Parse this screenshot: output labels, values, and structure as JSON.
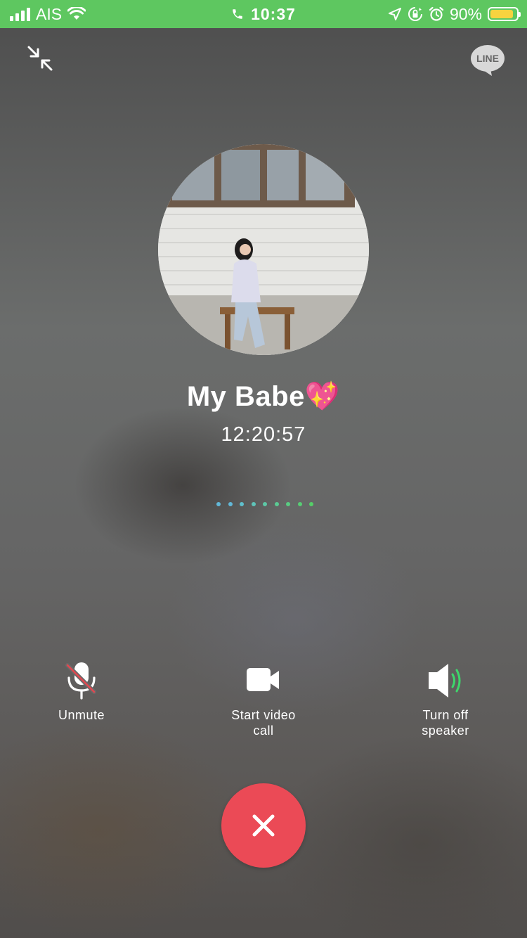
{
  "status_bar": {
    "carrier": "AIS",
    "time": "10:37",
    "battery_percent": "90%",
    "battery_level": 0.9,
    "icons": [
      "signal-icon",
      "wifi-icon",
      "phone-icon",
      "location-icon",
      "rotation-lock-icon",
      "alarm-icon",
      "battery-icon"
    ]
  },
  "header": {
    "minimize_icon": "minimize-icon",
    "logo_text": "LINE"
  },
  "call": {
    "contact_name": "My Babe💖",
    "duration": "12:20:57",
    "dot_colors": [
      "#62b8d8",
      "#62b8d8",
      "#5fbfcc",
      "#5fc4b9",
      "#5dc8a6",
      "#5bca93",
      "#59cc82",
      "#57cd74",
      "#55ce68"
    ]
  },
  "controls": {
    "mute": {
      "label": "Unmute",
      "icon": "microphone-off-icon"
    },
    "video": {
      "label": "Start video\ncall",
      "icon": "video-camera-icon"
    },
    "speaker": {
      "label": "Turn off\nspeaker",
      "icon": "speaker-on-icon"
    }
  },
  "end_call": {
    "icon": "close-icon",
    "color": "#eb4a56"
  },
  "colors": {
    "status_bar": "#5ec760",
    "speaker_waves": "#3ed66b",
    "mute_slash": "#e2474f"
  }
}
